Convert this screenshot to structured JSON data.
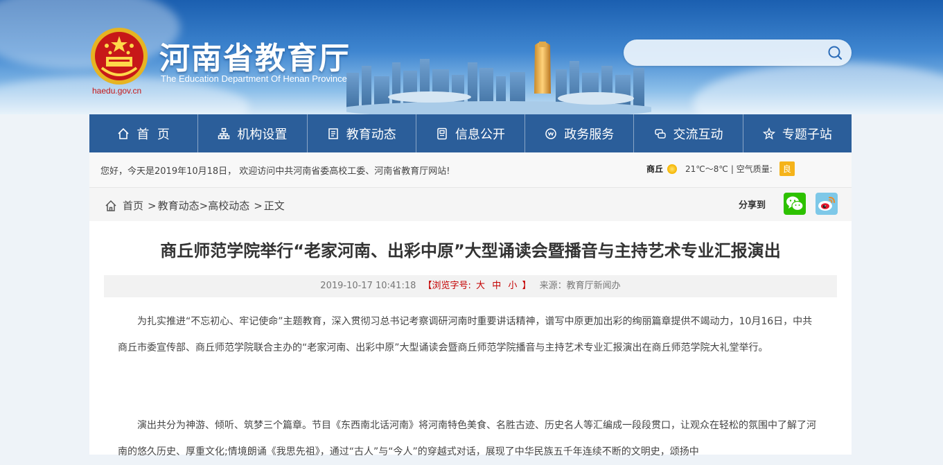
{
  "header": {
    "site_title": "河南省教育厅",
    "site_subtitle": "The Education Department Of Henan Province",
    "emblem_url": "haedu.gov.cn",
    "search_placeholder": ""
  },
  "nav": {
    "items": [
      {
        "label": "首  页",
        "icon": "home-icon"
      },
      {
        "label": "机构设置",
        "icon": "org-icon"
      },
      {
        "label": "教育动态",
        "icon": "news-icon"
      },
      {
        "label": "信息公开",
        "icon": "info-icon"
      },
      {
        "label": "政务服务",
        "icon": "service-icon"
      },
      {
        "label": "交流互动",
        "icon": "interact-icon"
      },
      {
        "label": "专题子站",
        "icon": "topic-icon"
      }
    ]
  },
  "infobar": {
    "welcome": "您好，今天是2019年10月18日， 欢迎访问中共河南省委高校工委、河南省教育厅网站!",
    "weather_city": "商丘",
    "weather_temp": "21℃～8℃",
    "aqi_label": "| 空气质量:",
    "aqi_value": "良"
  },
  "breadcrumb": {
    "home": "首页",
    "items": [
      "教育动态",
      "高校动态",
      "正文"
    ],
    "share_label": "分享到"
  },
  "article": {
    "title": "商丘师范学院举行“老家河南、出彩中原”大型诵读会暨播音与主持艺术专业汇报演出",
    "datetime": "2019-10-17 10:41:18",
    "fontsize_label": "【浏览字号:",
    "fontsize_large": "大",
    "fontsize_medium": "中",
    "fontsize_small": "小",
    "fontsize_end": "】",
    "source": "来源：教育厅新闻办",
    "paragraphs": [
      "为扎实推进“不忘初心、牢记使命”主题教育，深入贯彻习总书记考察调研河南时重要讲话精神，谱写中原更加出彩的绚丽篇章提供不竭动力，10月16日，中共商丘市委宣传部、商丘师范学院联合主办的“老家河南、出彩中原”大型诵读会暨商丘师范学院播音与主持艺术专业汇报演出在商丘师范学院大礼堂举行。",
      "演出共分为神游、倾听、筑梦三个篇章。节目《东西南北话河南》将河南特色美食、名胜古迹、历史名人等汇编成一段段贯口，让观众在轻松的氛围中了解了河南的悠久历史、厚重文化;情境朗诵《我思先祖》，通过“古人”与“今人”的穿越式对话，展现了中华民族五千年连续不断的文明史，颂扬中"
    ]
  },
  "colors": {
    "nav_bg": "#2b5e9a",
    "emblem_red": "#c71818",
    "fontsize_red": "#c40000",
    "aqi_bg": "#f5b31a",
    "wechat_green": "#2dc100"
  }
}
